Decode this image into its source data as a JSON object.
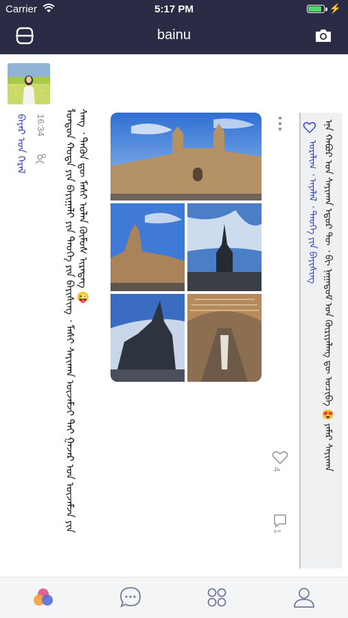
{
  "status_bar": {
    "carrier": "Carrier",
    "time": "5:17 PM",
    "wifi_icon": "wifi-icon",
    "battery_icon": "battery-icon"
  },
  "nav_bar": {
    "title": "bainu",
    "left_icon": "scan-icon",
    "right_icon": "camera-icon",
    "background": "#2a2c45"
  },
  "post": {
    "username": "ᠪᠠᠶᠠᠷ ᠤᠨ ᠭᠡᠷᠡᠯ",
    "time": "16:34",
    "text": "ᠯᠣᠨᠳᠣᠨ ᠬᠣᠲᠠ ᠶᠢᠨ ᠪᠠᠶᠢᠭᠠᠯᠢ ᠶᠢᠨ ᠲᠡᠦᠬᠡ ᠶᠢᠨ ᠪᠠᠶᠢᠰᠢᠩ ᠂ ᠮᠠᠰᠢ ᠰᠠᠶᠢᠬᠠᠨ ᠦᠵᠡᠮᠵᠢ ᠲᠠᠢ ᠭᠠᠵᠠᠷ ᠤᠨ ᠦᠵᠡᠮᠵᠡ ᠶᠢᠨ ᠰᠠᠩ ᠂ ᠲᠡᠭᠦᠨ ᠳᠦ ᠮᠠᠰᠢ ᠣᠯᠠᠨ ᠬᠦᠮᠦᠰ ᠢᠷᠡᠳᠡᠭ 😜",
    "like_count": "4",
    "comment_count": "1",
    "photos": [
      "museum-facade",
      "museum-tower",
      "memorial-spire",
      "horse-statue",
      "museum-hall"
    ]
  },
  "quoted": {
    "text": "ᠡᠨᠡ ᠬᠠᠪᠤᠷ ᠤᠨ ᠰᠠᠶᠢᠬᠠᠨ ᠡᠳᠦᠷ ᠲᠦ ᠂ ᠪᠢ ᠨᠠᠭᠠᠳᠤᠮ ᠤᠨ ᠬᠦᠷᠢᠶᠡᠯᠡᠩ ᠳᠦ ᠣᠴᠢᠪᠠ 😍 ᠶᠠᠮᠠᠷ ᠰᠠᠶᠢᠬᠠᠨ",
    "tags": "ᠤᠷᠠᠯᠢᠭ ᠂ ᠠᠶᠠᠯᠠᠯ ᠂ ᠲᠡᠦᠬᠡ ᠶᠢᠨ ᠪᠠᠶᠢᠰᠢᠩ"
  },
  "tab_bar": {
    "tabs": [
      "discover-icon",
      "chat-icon",
      "apps-icon",
      "profile-icon"
    ],
    "active_color": "#d94a7a"
  }
}
